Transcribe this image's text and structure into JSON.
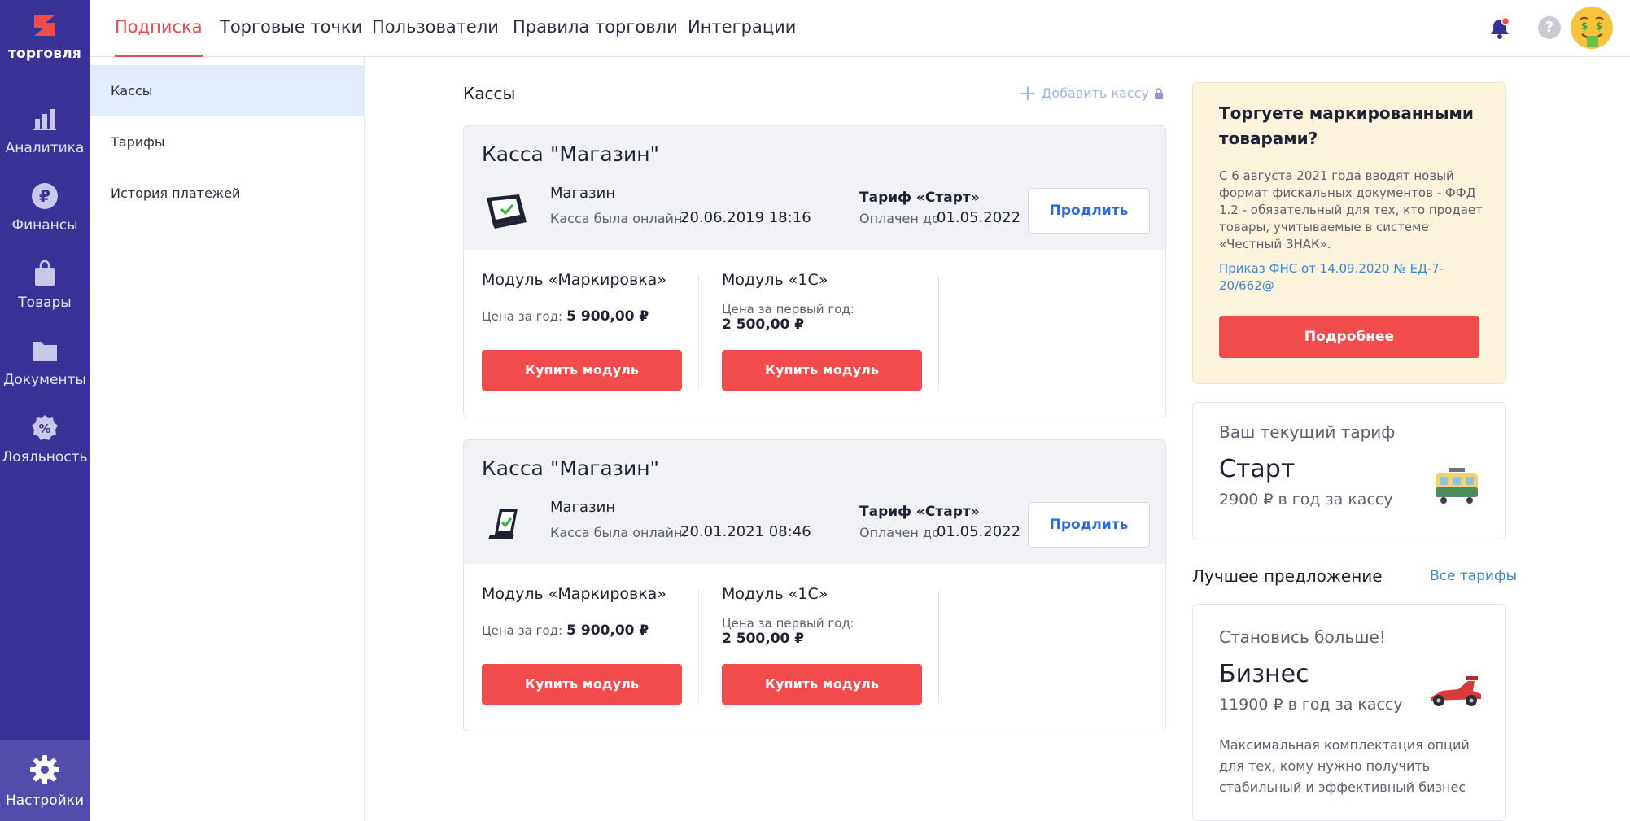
{
  "rail": {
    "logo_text": "торговля",
    "items": [
      {
        "label": "Аналитика",
        "icon": "bar-chart-icon"
      },
      {
        "label": "Финансы",
        "icon": "ruble-coin-icon"
      },
      {
        "label": "Товары",
        "icon": "shopping-bag-icon"
      },
      {
        "label": "Документы",
        "icon": "folder-icon"
      },
      {
        "label": "Лояльность",
        "icon": "percent-badge-icon"
      }
    ],
    "settings_label": "Настройки",
    "colors": {
      "background": "#3a3397",
      "active": "#524cab"
    }
  },
  "topbar": {
    "tabs": [
      {
        "label": "Подписка",
        "active": true
      },
      {
        "label": "Торговые точки",
        "active": false
      },
      {
        "label": "Пользователи",
        "active": false
      },
      {
        "label": "Правила торговли",
        "active": false
      },
      {
        "label": "Интеграции",
        "active": false
      }
    ],
    "help_glyph": "?",
    "accent": "#e94a4a"
  },
  "subnav": {
    "items": [
      {
        "label": "Кассы",
        "active": true
      },
      {
        "label": "Тарифы",
        "active": false
      },
      {
        "label": "История платежей",
        "active": false
      }
    ]
  },
  "main": {
    "title": "Кассы",
    "add_label": "Добавить кассу",
    "kassas": [
      {
        "title": "Касса \"Магазин\"",
        "shop": "Магазин",
        "online_label": "Касса была онлайн:",
        "online_value": "20.06.2019 18:16",
        "tarif": "Тариф «Старт»",
        "paid_label": "Оплачен до",
        "paid_value": "01.05.2022",
        "renew_label": "Продлить",
        "modules": [
          {
            "title": "Модуль «Маркировка»",
            "price_label": "Цена за год:",
            "price_value": "5 900,00 ₽",
            "buy_label": "Купить модуль"
          },
          {
            "title": "Модуль «1С»",
            "price_label": "Цена за первый год:",
            "price_value": "2 500,00 ₽",
            "buy_label": "Купить модуль"
          }
        ]
      },
      {
        "title": "Касса \"Магазин\"",
        "shop": "Магазин",
        "online_label": "Касса была онлайн:",
        "online_value": "20.01.2021 08:46",
        "tarif": "Тариф «Старт»",
        "paid_label": "Оплачен до",
        "paid_value": "01.05.2022",
        "renew_label": "Продлить",
        "modules": [
          {
            "title": "Модуль «Маркировка»",
            "price_label": "Цена за год:",
            "price_value": "5 900,00 ₽",
            "buy_label": "Купить модуль"
          },
          {
            "title": "Модуль «1С»",
            "price_label": "Цена за первый год:",
            "price_value": "2 500,00 ₽",
            "buy_label": "Купить модуль"
          }
        ]
      }
    ]
  },
  "promo": {
    "title": "Торгуете маркированными товарами?",
    "text": "С 6 августа 2021 года вводят новый формат фискальных документов - ФФД 1.2 - обязательный для тех, кто продает товары, учитываемые в системе «Честный ЗНАК».",
    "link": "Приказ ФНС от 14.09.2020 № ЕД-7-20/662@",
    "button": "Подробнее"
  },
  "current_tarif": {
    "label": "Ваш текущий тариф",
    "name": "Старт",
    "price": "2900 ₽ в год за кассу",
    "icon": "tram-icon"
  },
  "best_offer": {
    "title": "Лучшее предложение",
    "all_link": "Все тарифы",
    "label": "Становись больше!",
    "name": "Бизнес",
    "price": "11900 ₽ в год за кассу",
    "text": "Максимальная комплектация опций для тех, кому нужно получить стабильный и эффективный бизнес",
    "icon": "race-car-icon"
  }
}
